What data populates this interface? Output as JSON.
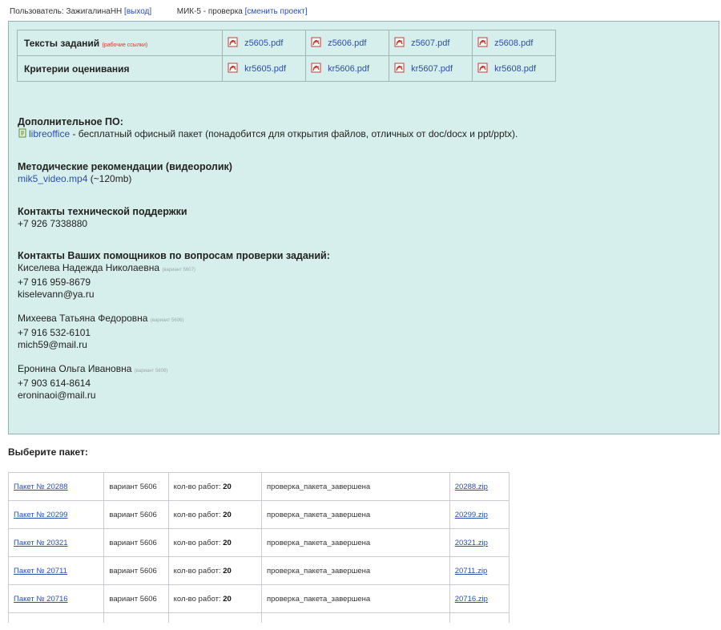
{
  "topbar": {
    "user_label": "Пользователь: ЗажигалинаНН",
    "logout": "[выход]",
    "project": "МИК-5 - проверка",
    "change_project": "[сменить проект]"
  },
  "docs": {
    "tasks_label": "Тексты заданий",
    "tasks_note": "(рабочие ссылки)",
    "tasks_files": [
      "z5605.pdf",
      "z5606.pdf",
      "z5607.pdf",
      "z5608.pdf"
    ],
    "criteria_label": "Критерии оценивания",
    "criteria_files": [
      "kr5605.pdf",
      "kr5606.pdf",
      "kr5607.pdf",
      "kr5608.pdf"
    ]
  },
  "software": {
    "heading": "Дополнительное ПО:",
    "link": "libreoffice",
    "text": " - бесплатный офисный пакет (понадобится для открытия файлов, отличных от doc/docx и ppt/pptx)."
  },
  "video": {
    "heading": "Методические рекомендации (видеоролик)",
    "link": "mik5_video.mp4",
    "size": " (~120mb)"
  },
  "support": {
    "heading": "Контакты технической поддержки",
    "phone": "+7 926 7338880"
  },
  "helpers": {
    "heading": "Контакты Ваших помощников по вопросам проверки заданий:",
    "people": [
      {
        "name": "Киселева Надежда Николаевна",
        "variant": "(вариант 5607)",
        "phone": "+7 916 959-8679",
        "email": "kiselevann@ya.ru"
      },
      {
        "name": "Михеева Татьяна Федоровна",
        "variant": "(вариант 5606)",
        "phone": "+7 916 532-6101",
        "email": "mich59@mail.ru"
      },
      {
        "name": "Еронина Ольга Ивановна",
        "variant": "(вариант 5608)",
        "phone": "+7 903 614-8614",
        "email": "eroninaoi@mail.ru"
      }
    ]
  },
  "packages": {
    "heading": "Выберите пакет:",
    "count_label": "кол-во работ:",
    "rows": [
      {
        "id": "Пакет № 20288",
        "variant": "вариант 5606",
        "count": "20",
        "status": "проверка_пакета_завершена",
        "zip": "20288.zip"
      },
      {
        "id": "Пакет № 20299",
        "variant": "вариант 5606",
        "count": "20",
        "status": "проверка_пакета_завершена",
        "zip": "20299.zip"
      },
      {
        "id": "Пакет № 20321",
        "variant": "вариант 5606",
        "count": "20",
        "status": "проверка_пакета_завершена",
        "zip": "20321.zip"
      },
      {
        "id": "Пакет № 20711",
        "variant": "вариант 5606",
        "count": "20",
        "status": "проверка_пакета_завершена",
        "zip": "20711.zip"
      },
      {
        "id": "Пакет № 20716",
        "variant": "вариант 5606",
        "count": "20",
        "status": "проверка_пакета_завершена",
        "zip": "20716.zip"
      }
    ]
  },
  "icons": {
    "pdf": "pdf-icon",
    "software": "libreoffice-icon"
  },
  "colors": {
    "panel_bg": "#d6efec",
    "link": "#2a4db0",
    "pdf_red": "#d23a2a"
  }
}
